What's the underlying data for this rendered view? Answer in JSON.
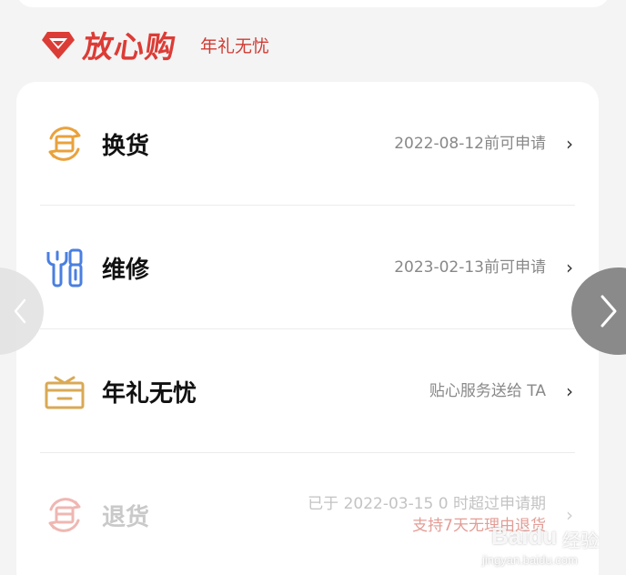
{
  "header": {
    "brand_title": "放心购",
    "brand_subtitle": "年礼无忧",
    "brand_icon": "diamond-icon"
  },
  "colors": {
    "brand_red": "#dc3c36",
    "exchange_orange": "#e9a23b",
    "repair_blue": "#4a7fe0",
    "gift_gold": "#d9a955"
  },
  "services": [
    {
      "icon": "exchange-icon",
      "title": "换货",
      "info": "2022-08-12前可申请",
      "chevron": "›",
      "enabled": true
    },
    {
      "icon": "repair-tools-icon",
      "title": "维修",
      "info": "2023-02-13前可申请",
      "chevron": "›",
      "enabled": true
    },
    {
      "icon": "gift-box-icon",
      "title": "年礼无忧",
      "info": "贴心服务送给 TA",
      "chevron": "›",
      "enabled": true
    },
    {
      "icon": "return-icon",
      "title": "退货",
      "info_line1": "已于 2022-03-15 0 时超过申请期",
      "info_line2": "支持7天无理由退货",
      "chevron": "›",
      "enabled": false
    }
  ],
  "nav": {
    "prev_glyph": "‹",
    "next_glyph": "›"
  },
  "watermark": {
    "brand": "Baidu",
    "cn": "经验",
    "url": "jingyan.baidu.com"
  }
}
